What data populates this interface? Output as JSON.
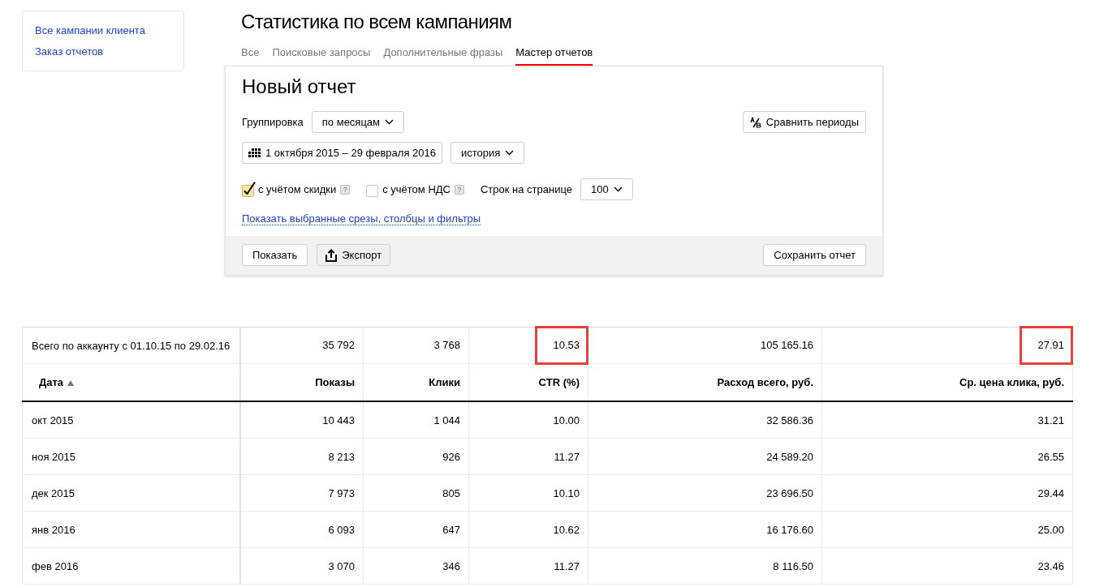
{
  "sidebar": {
    "links": [
      "Все кампании клиента",
      "Заказ отчетов"
    ]
  },
  "page_title": "Статистика по всем кампаниям",
  "tabs": [
    {
      "label": "Все",
      "selected": false
    },
    {
      "label": "Поисковые запросы",
      "selected": false
    },
    {
      "label": "Дополнительные фразы",
      "selected": false
    },
    {
      "label": "Мастер отчетов",
      "selected": true
    }
  ],
  "report": {
    "title": "Новый отчет",
    "grouping": {
      "label": "Группировка",
      "value": "по месяцам"
    },
    "compare_button": "Сравнить периоды",
    "date_range": "1 октября 2015 – 29 февраля 2016",
    "history": "история",
    "options": [
      {
        "label": "с учётом скидки",
        "checked": true,
        "hint": "?"
      },
      {
        "label": "с учётом НДС",
        "checked": false,
        "hint": "?"
      }
    ],
    "rows_per_page": {
      "label": "Строк на странице",
      "value": "100"
    },
    "show_link": "Показать выбранные срезы, столбцы и фильтры",
    "footer_buttons": [
      {
        "label": "Показать",
        "kind": "show"
      },
      {
        "label": "Экспорт",
        "kind": "export"
      },
      {
        "label": "Сохранить отчет",
        "kind": "save"
      }
    ]
  },
  "table": {
    "summary": {
      "label": "Всего по аккаунту с 01.10.15 по 29.02.16",
      "values": [
        {
          "text": "35 792",
          "highlighted": false
        },
        {
          "text": "3 768",
          "highlighted": false
        },
        {
          "text": "10.53",
          "highlighted": true
        },
        {
          "text": "105 165.16",
          "highlighted": false
        },
        {
          "text": "27.91",
          "highlighted": true
        }
      ]
    },
    "columns": [
      {
        "label": "Дата",
        "sorted": true
      },
      {
        "label": "Показы",
        "sorted": false
      },
      {
        "label": "Клики",
        "sorted": false
      },
      {
        "label": "CTR (%)",
        "sorted": false
      },
      {
        "label": "Расход всего, руб.",
        "sorted": false
      },
      {
        "label": "Ср. цена клика, руб.",
        "sorted": false
      }
    ],
    "rows": [
      [
        "окт 2015",
        "10 443",
        "1 044",
        "10.00",
        "32 586.36",
        "31.21"
      ],
      [
        "ноя 2015",
        "8 213",
        "926",
        "11.27",
        "24 589.20",
        "26.55"
      ],
      [
        "дек 2015",
        "7 973",
        "805",
        "10.10",
        "23 696.50",
        "29.44"
      ],
      [
        "янв 2016",
        "6 093",
        "647",
        "10.62",
        "16 176.60",
        "25.00"
      ],
      [
        "фев 2016",
        "3 070",
        "346",
        "11.27",
        "8 116.50",
        "23.46"
      ]
    ]
  }
}
